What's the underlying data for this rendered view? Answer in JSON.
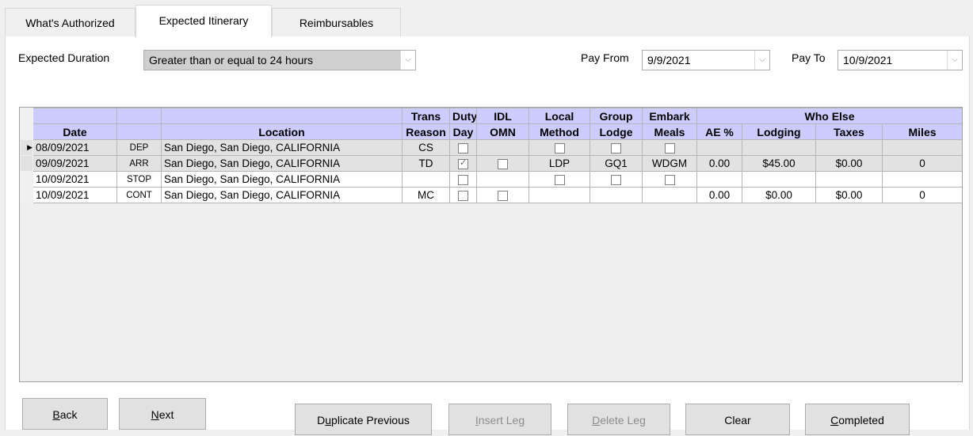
{
  "tabs": [
    {
      "label": "What's Authorized"
    },
    {
      "label": "Expected Itinerary"
    },
    {
      "label": "Reimbursables"
    }
  ],
  "duration": {
    "label": "Expected Duration",
    "value": "Greater than or equal to 24 hours"
  },
  "pay_from": {
    "label": "Pay From",
    "value": "9/9/2021"
  },
  "pay_to": {
    "label": "Pay To",
    "value": "10/9/2021"
  },
  "grid": {
    "group_headers": {
      "trans": "Trans",
      "duty": "Duty",
      "idl": "IDL",
      "local": "Local",
      "group": "Group",
      "embark": "Embark",
      "who_else": "Who Else"
    },
    "headers": {
      "date": "Date",
      "location": "Location",
      "reason": "Reason",
      "day": "Day",
      "omn": "OMN",
      "method": "Method",
      "lodge": "Lodge",
      "meals": "Meals",
      "ae": "AE %",
      "lodging": "Lodging",
      "taxes": "Taxes",
      "miles": "Miles"
    },
    "current_row_marker": "▶",
    "rows": [
      {
        "date": "08/09/2021",
        "type": "DEP",
        "location": "San Diego, San Diego, CALIFORNIA",
        "reason": "CS",
        "duty_day": "unchecked",
        "idl": "",
        "local_method": "unchecked",
        "group_lodge": "unchecked",
        "embark": "unchecked",
        "ae": "",
        "lodging": "",
        "taxes": "",
        "miles": ""
      },
      {
        "date": "09/09/2021",
        "type": "ARR",
        "location": "San Diego, San Diego, CALIFORNIA",
        "reason": "TD",
        "duty_day": "checked",
        "idl": "unchecked",
        "local_method": "LDP",
        "group_lodge": "GQ1",
        "embark": "WDGM",
        "ae": "0.00",
        "lodging": "$45.00",
        "taxes": "$0.00",
        "miles": "0"
      },
      {
        "date": "10/09/2021",
        "type": "STOP",
        "location": "San Diego, San Diego, CALIFORNIA",
        "reason": "",
        "duty_day": "unchecked",
        "idl": "",
        "local_method": "unchecked",
        "group_lodge": "unchecked",
        "embark": "unchecked",
        "ae": "",
        "lodging": "",
        "taxes": "",
        "miles": ""
      },
      {
        "date": "10/09/2021",
        "type": "CONT",
        "location": "San Diego, San Diego, CALIFORNIA",
        "reason": "MC",
        "duty_day": "unchecked",
        "idl": "unchecked",
        "local_method": "",
        "group_lodge": "",
        "embark": "",
        "ae": "0.00",
        "lodging": "$0.00",
        "taxes": "$0.00",
        "miles": "0"
      }
    ]
  },
  "buttons": {
    "back": {
      "ul": "B",
      "rest": "ack"
    },
    "next": {
      "ul": "N",
      "rest": "ext"
    },
    "duplicate": {
      "pre": "D",
      "ul": "u",
      "rest": "plicate Previous"
    },
    "insert": {
      "ul": "I",
      "rest": "nsert Leg"
    },
    "delete": {
      "ul": "D",
      "rest": "elete Leg"
    },
    "clear": {
      "label": "Clear"
    },
    "completed": {
      "ul": "C",
      "rest": "ompleted"
    }
  }
}
